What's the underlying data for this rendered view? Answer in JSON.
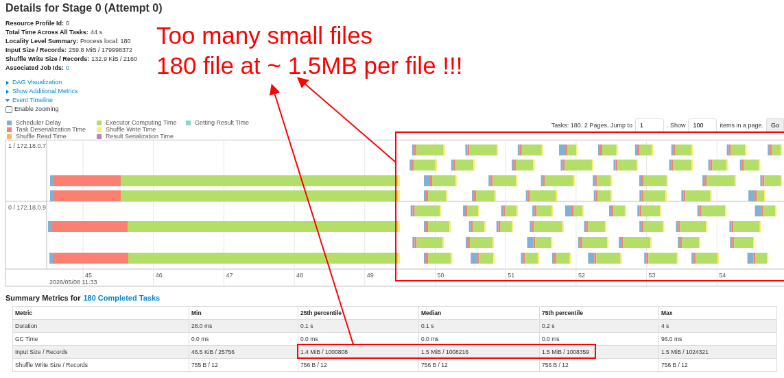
{
  "title": "Details for Stage 0 (Attempt 0)",
  "info": [
    {
      "label": "Resource Profile Id:",
      "value": "0",
      "kind": "text"
    },
    {
      "label": "Total Time Across All Tasks:",
      "value": "44 s",
      "kind": "text"
    },
    {
      "label": "Locality Level Summary:",
      "value": "Process local: 180",
      "kind": "text"
    },
    {
      "label": "Input Size / Records:",
      "value": "259.8 MiB / 179998372",
      "kind": "text"
    },
    {
      "label": "Shuffle Write Size / Records:",
      "value": "132.9 KiB / 2160",
      "kind": "text"
    },
    {
      "label": "Associated Job Ids:",
      "value": "0",
      "kind": "link"
    }
  ],
  "toggles": [
    {
      "label": "DAG Visualization",
      "expanded": false
    },
    {
      "label": "Show Additional Metrics",
      "expanded": false
    },
    {
      "label": "Event Timeline",
      "expanded": true
    }
  ],
  "enable_zooming": {
    "label": "Enable zooming",
    "checked": false
  },
  "legend": [
    {
      "label": "Scheduler Delay",
      "color": "#80b1d3"
    },
    {
      "label": "Task Deserialization Time",
      "color": "#fb8072"
    },
    {
      "label": "Shuffle Read Time",
      "color": "#fdb462"
    },
    {
      "label": "Executor Computing Time",
      "color": "#b3de69"
    },
    {
      "label": "Shuffle Write Time",
      "color": "#ffed6f"
    },
    {
      "label": "Result Serialization Time",
      "color": "#bc80bd"
    },
    {
      "label": "Getting Result Time",
      "color": "#8dd3c7"
    }
  ],
  "pagination": {
    "prefix": "Tasks: 180. 2 Pages. Jump to",
    "page": "1",
    "show_label": ". Show",
    "page_size": "100",
    "suffix": "items in a page.",
    "button": "Go"
  },
  "timeline": {
    "executors": [
      {
        "name": "1 / 172.18.0.7"
      },
      {
        "name": "0 / 172.18.0.9"
      }
    ],
    "ticks": [
      "45",
      "46",
      "47",
      "48",
      "49",
      "50",
      "51",
      "52",
      "53",
      "54"
    ],
    "date_label": "2026/05/08 11:33"
  },
  "summary": {
    "heading": "Summary Metrics for",
    "link": "180 Completed Tasks"
  },
  "table": {
    "columns": [
      "Metric",
      "Min",
      "25th percentile",
      "Median",
      "75th percentile",
      "Max"
    ],
    "rows": [
      [
        "Duration",
        "28.0 ms",
        "0.1 s",
        "0.1 s",
        "0.2 s",
        "4 s"
      ],
      [
        "GC Time",
        "0.0 ms",
        "0.0 ms",
        "0.0 ms",
        "0.0 ms",
        "96.0 ms"
      ],
      [
        "Input Size / Records",
        "46.5 KiB / 25756",
        "1.4 MiB / 1000808",
        "1.5 MiB / 1008216",
        "1.5 MiB / 1008359",
        "1.5 MiB / 1024321"
      ],
      [
        "Shuffle Write Size / Records",
        "755 B / 12",
        "756 B / 12",
        "756 B / 12",
        "756 B / 12",
        "756 B / 12"
      ]
    ]
  },
  "annotation": {
    "lines": [
      "Too many small files",
      "180 file at ~ 1.5MB per file !!!"
    ]
  }
}
